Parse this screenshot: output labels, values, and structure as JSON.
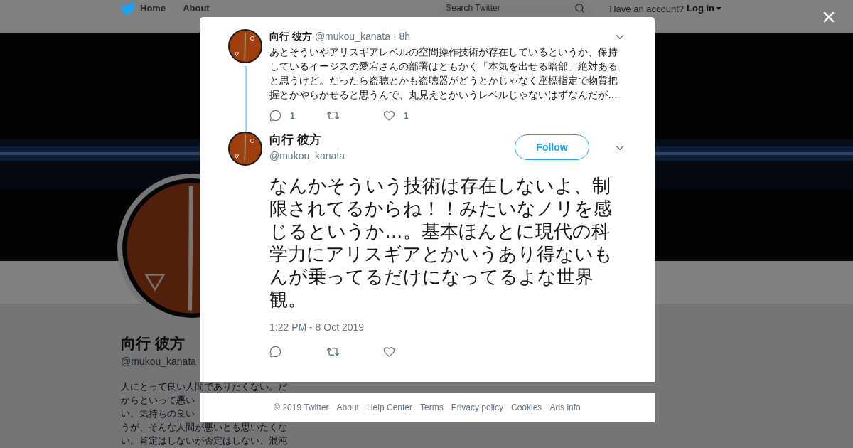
{
  "background_page": {
    "nav": [
      {
        "label": "Home",
        "kind": "home"
      },
      {
        "label": "About",
        "kind": "plain"
      }
    ],
    "search": {
      "placeholder": "Search Twitter"
    },
    "account_prompt": "Have an account?",
    "login": "Log in",
    "profile": {
      "name": "向行 彼方",
      "handle": "@mukou_kanata",
      "bio_lines": [
        "人にとって良い人間でありたくない。だ",
        "からといって悪い",
        "い。気持ちの良い",
        "うが、そんな人間が悪いとも思いたくな",
        "い。肯定はしないが否定はしない、混沌"
      ]
    }
  },
  "modal": {
    "tweets": [
      {
        "kind": "parent",
        "name": "向行 彼方",
        "handle": "@mukou_kanata",
        "time": "· 8h",
        "text": "あとそういやアリスギアレベルの空間操作技術が存在しているというか、保持しているイージスの愛宕さんの部署はともかく「本気を出せる暗部」絶対あると思うけど。だったら盗聴とかも盗聴器がどうとかじゃなく座標指定で物質把握とかやらかせると思うんで、丸見えとかいうレベルじゃないはずなんだが…",
        "reply_count": "1",
        "like_count": "1"
      },
      {
        "kind": "focused",
        "name": "向行 彼方",
        "handle": "@mukou_kanata",
        "follow": "Follow",
        "text": "なんかそういう技術は存在しないよ、制限されてるからね！！みたいなノリを感じるというか…。基本ほんとに現代の科学力にアリスギアとかいうあり得ないもんが乗ってるだけになってるよな世界観。",
        "timestamp": "1:22 PM - 8 Oct 2019"
      }
    ]
  },
  "footer": {
    "links": [
      "© 2019 Twitter",
      "About",
      "Help Center",
      "Terms",
      "Privacy policy",
      "Cookies",
      "Ads info"
    ]
  }
}
